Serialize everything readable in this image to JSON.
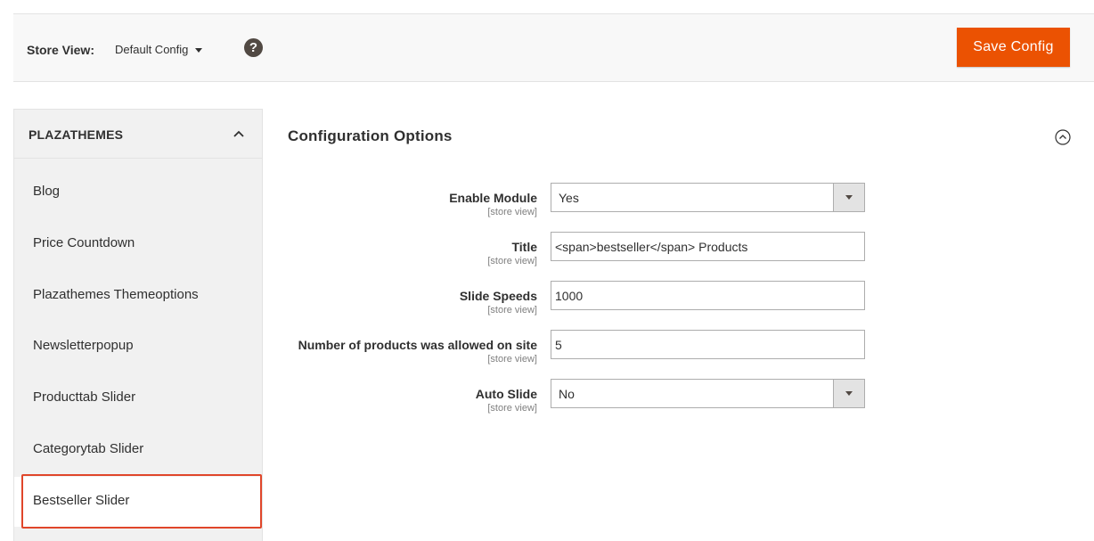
{
  "store_bar": {
    "label": "Store View:",
    "selected_scope": "Default Config",
    "help_glyph": "?",
    "save_label": "Save Config"
  },
  "sidebar": {
    "group_title": "PLAZATHEMES",
    "items": [
      {
        "label": "Blog"
      },
      {
        "label": "Price Countdown"
      },
      {
        "label": "Plazathemes Themeoptions"
      },
      {
        "label": "Newsletterpopup"
      },
      {
        "label": "Producttab Slider"
      },
      {
        "label": "Categorytab Slider"
      },
      {
        "label": "Bestseller Slider",
        "active": true
      }
    ]
  },
  "main": {
    "section_title": "Configuration Options",
    "fields": [
      {
        "label": "Enable Module",
        "scope": "[store view]",
        "type": "select",
        "value": "Yes"
      },
      {
        "label": "Title",
        "scope": "[store view]",
        "type": "text",
        "value": "<span>bestseller</span> Products"
      },
      {
        "label": "Slide Speeds",
        "scope": "[store view]",
        "type": "text",
        "value": "1000"
      },
      {
        "label": "Number of products was allowed on site",
        "scope": "[store view]",
        "type": "text",
        "value": "5"
      },
      {
        "label": "Auto Slide",
        "scope": "[store view]",
        "type": "select",
        "value": "No"
      }
    ]
  },
  "colors": {
    "accent": "#eb5202",
    "highlight": "#e0462a",
    "sidebar_bg": "#f1f1f1",
    "header_bg": "#f8f8f8"
  }
}
